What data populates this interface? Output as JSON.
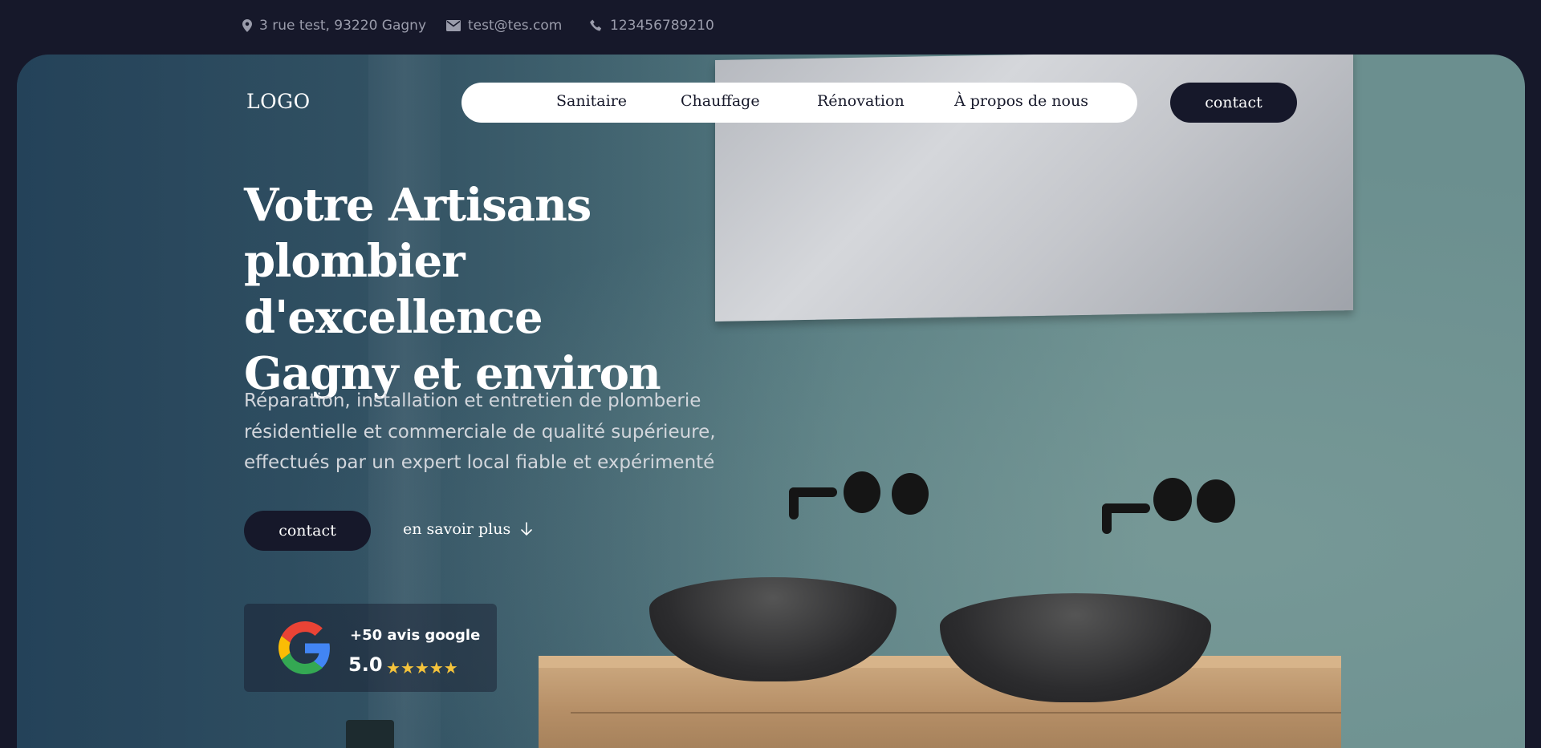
{
  "topbar": {
    "address": "3 rue test, 93220 Gagny",
    "email": "test@tes.com",
    "phone": "123456789210"
  },
  "header": {
    "logo": "LOGO",
    "nav": [
      {
        "label": "Sanitaire"
      },
      {
        "label": "Chauffage"
      },
      {
        "label": "Rénovation"
      },
      {
        "label": "À propos de nous"
      }
    ],
    "cta": "contact"
  },
  "hero": {
    "title_lines": [
      "Votre Artisans",
      "plombier d'excellence",
      "Gagny et environ"
    ],
    "subtitle_lines": [
      "Réparation, installation et entretien de plomberie",
      "résidentielle et commerciale de qualité supérieure,",
      "effectués par un expert local fiable et expérimenté"
    ],
    "cta_primary": "contact",
    "cta_secondary": "en savoir plus"
  },
  "review": {
    "count_label": "+50 avis google",
    "score": "5.0",
    "stars": 5
  },
  "colors": {
    "dark": "#16182a",
    "star": "#f5c33b",
    "nav_bg": "#ffffff"
  },
  "icons": [
    "location-pin-icon",
    "mail-icon",
    "phone-icon",
    "arrow-down-icon",
    "google-icon",
    "star-icon"
  ]
}
